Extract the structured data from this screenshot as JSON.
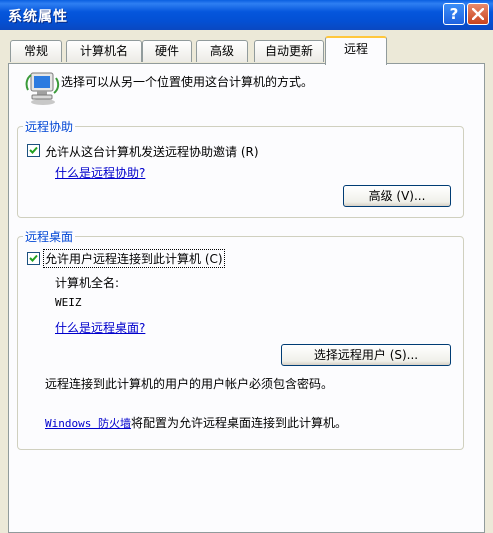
{
  "window": {
    "title": "系统属性"
  },
  "tabs": [
    {
      "label": "常规"
    },
    {
      "label": "计算机名"
    },
    {
      "label": "硬件"
    },
    {
      "label": "高级"
    },
    {
      "label": "自动更新"
    },
    {
      "label": "远程"
    }
  ],
  "intro": {
    "text": "选择可以从另一个位置使用这台计算机的方式。"
  },
  "remote_assistance": {
    "title": "远程协助",
    "checkbox_label": "允许从这台计算机发送远程协助邀请 (R)",
    "checked": true,
    "help_link": "什么是远程协助?",
    "advanced_button": "高级 (V)..."
  },
  "remote_desktop": {
    "title": "远程桌面",
    "checkbox_label": "允许用户远程连接到此计算机 (C)",
    "checked": true,
    "computer_name_label": "计算机全名:",
    "computer_name": "WEIZ",
    "help_link": "什么是远程桌面?",
    "select_users_button": "选择远程用户 (S)...",
    "password_note": "远程连接到此计算机的用户的用户帐户必须包含密码。",
    "firewall_link": "Windows 防火墙",
    "firewall_note": "将配置为允许远程桌面连接到此计算机。"
  }
}
